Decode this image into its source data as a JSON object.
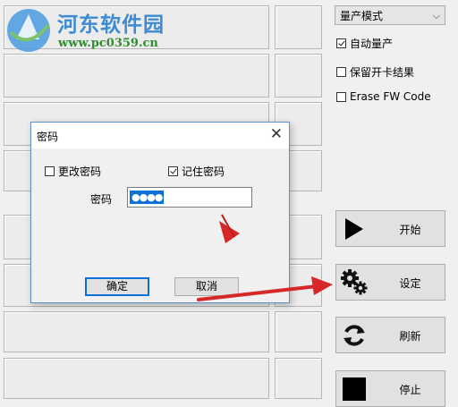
{
  "watermark": {
    "title": "河东软件园",
    "url": "www.pc0359.cn"
  },
  "right_panel": {
    "mode_select": {
      "value": "量产模式"
    },
    "checkboxes": [
      {
        "label": "自动量产",
        "checked": true
      },
      {
        "label": "保留开卡结果",
        "checked": false
      },
      {
        "label": "Erase FW Code",
        "checked": false
      }
    ],
    "buttons": {
      "start": "开始",
      "settings": "设定",
      "refresh": "刷新",
      "stop": "停止"
    }
  },
  "dialog": {
    "title": "密码",
    "close_glyph": "✕",
    "change_password": {
      "label": "更改密码",
      "checked": false
    },
    "remember_password": {
      "label": "记住密码",
      "checked": true
    },
    "password_label": "密码",
    "password_mask": "●●●●",
    "ok": "确定",
    "cancel": "取消"
  },
  "colors": {
    "accent": "#0a6fd7",
    "arrow": "#d62828",
    "watermark_blue": "#3e8bd3",
    "watermark_green": "#2e8e2e"
  }
}
